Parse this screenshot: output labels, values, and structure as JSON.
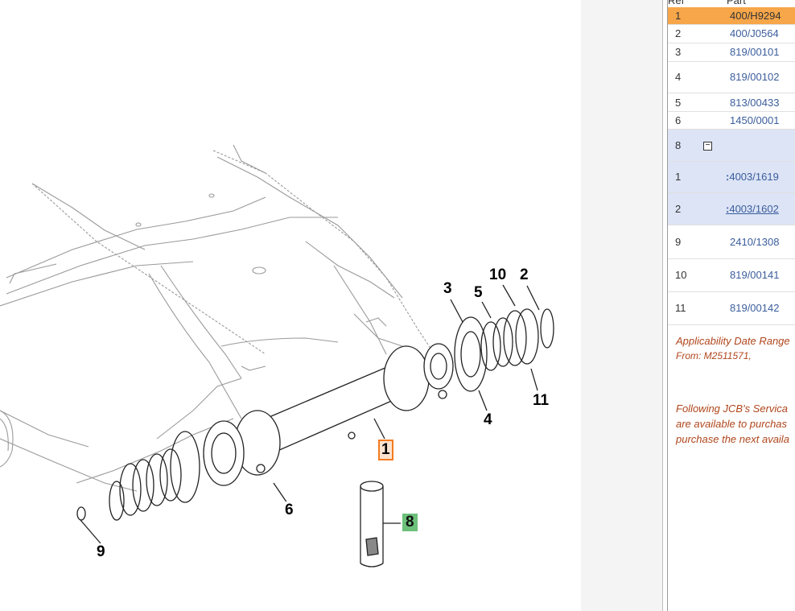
{
  "diagram": {
    "callouts": [
      {
        "id": "1",
        "label": "1",
        "selected": true
      },
      {
        "id": "2",
        "label": "2"
      },
      {
        "id": "3",
        "label": "3"
      },
      {
        "id": "4",
        "label": "4"
      },
      {
        "id": "5",
        "label": "5"
      },
      {
        "id": "6",
        "label": "6"
      },
      {
        "id": "8",
        "label": "8",
        "highlight": "green"
      },
      {
        "id": "9",
        "label": "9"
      },
      {
        "id": "10",
        "label": "10"
      },
      {
        "id": "11",
        "label": "11"
      }
    ]
  },
  "parts_panel": {
    "header": {
      "ref": "Ref",
      "part_no": "Part No"
    },
    "rows": [
      {
        "ref": "1",
        "part_no": "400/H9294",
        "selected": true
      },
      {
        "ref": "2",
        "part_no": "400/J0564"
      },
      {
        "ref": "3",
        "part_no": "819/00101"
      },
      {
        "ref": "4",
        "part_no": "819/00102"
      },
      {
        "ref": "5",
        "part_no": "813/00433"
      },
      {
        "ref": "6",
        "part_no": "1450/0001"
      },
      {
        "ref": "8",
        "part_no": "",
        "expander": "−",
        "kit": true
      },
      {
        "ref": "1",
        "prefix": ":",
        "part_no": "4003/1619",
        "kit": true
      },
      {
        "ref": "2",
        "prefix": ":",
        "part_no": "4003/1602",
        "kit": true,
        "link": true
      },
      {
        "ref": "9",
        "part_no": "2410/1308"
      },
      {
        "ref": "10",
        "part_no": "819/00141"
      },
      {
        "ref": "11",
        "part_no": "819/00142"
      }
    ],
    "applicability_title": "Applicability Date Range",
    "applicability_from": "From: M2511571,",
    "service_note_1": "Following JCB's Servica",
    "service_note_2": "are available to purchas",
    "service_note_3": "purchase the next availa"
  }
}
